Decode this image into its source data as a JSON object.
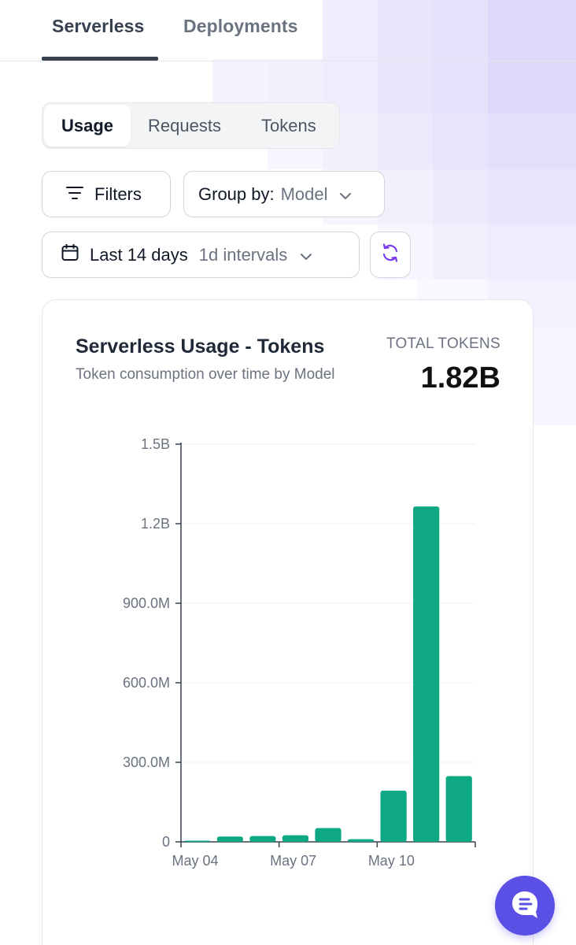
{
  "tabs": [
    {
      "label": "Serverless",
      "active": true
    },
    {
      "label": "Deployments",
      "active": false
    }
  ],
  "segmented": [
    "Usage",
    "Requests",
    "Tokens"
  ],
  "filters": {
    "filters_label": "Filters",
    "group_by_label": "Group by:",
    "group_by_value": "Model",
    "date_range_label": "Last 14 days",
    "interval_label": "1d intervals"
  },
  "card": {
    "title": "Serverless Usage - Tokens",
    "subtitle": "Token consumption over time by Model",
    "total_label": "TOTAL TOKENS",
    "total_value": "1.82B"
  },
  "colors": {
    "bar": "#0ea884",
    "accent": "#7c3aed",
    "chat": "#5b50e6"
  },
  "chart_data": {
    "type": "bar",
    "title": "Serverless Usage - Tokens",
    "subtitle": "Token consumption over time by Model",
    "xlabel": "",
    "ylabel": "",
    "ylim": [
      0,
      1500000000
    ],
    "y_ticks": [
      {
        "value": 0,
        "label": "0"
      },
      {
        "value": 300000000,
        "label": "300.0M"
      },
      {
        "value": 600000000,
        "label": "600.0M"
      },
      {
        "value": 900000000,
        "label": "900.0M"
      },
      {
        "value": 1200000000,
        "label": "1.2B"
      },
      {
        "value": 1500000000,
        "label": "1.5B"
      }
    ],
    "x_ticks": [
      {
        "index": 0,
        "label": "May 04"
      },
      {
        "index": 3,
        "label": "May 07"
      },
      {
        "index": 6,
        "label": "May 10"
      }
    ],
    "categories": [
      "May 04",
      "May 05",
      "May 06",
      "May 07",
      "May 08",
      "May 09",
      "May 10",
      "May 11",
      "May 12"
    ],
    "values": [
      3000000,
      20000000,
      22000000,
      25000000,
      52000000,
      10000000,
      193000000,
      1265000000,
      248000000
    ],
    "grid": true,
    "legend": "none"
  }
}
